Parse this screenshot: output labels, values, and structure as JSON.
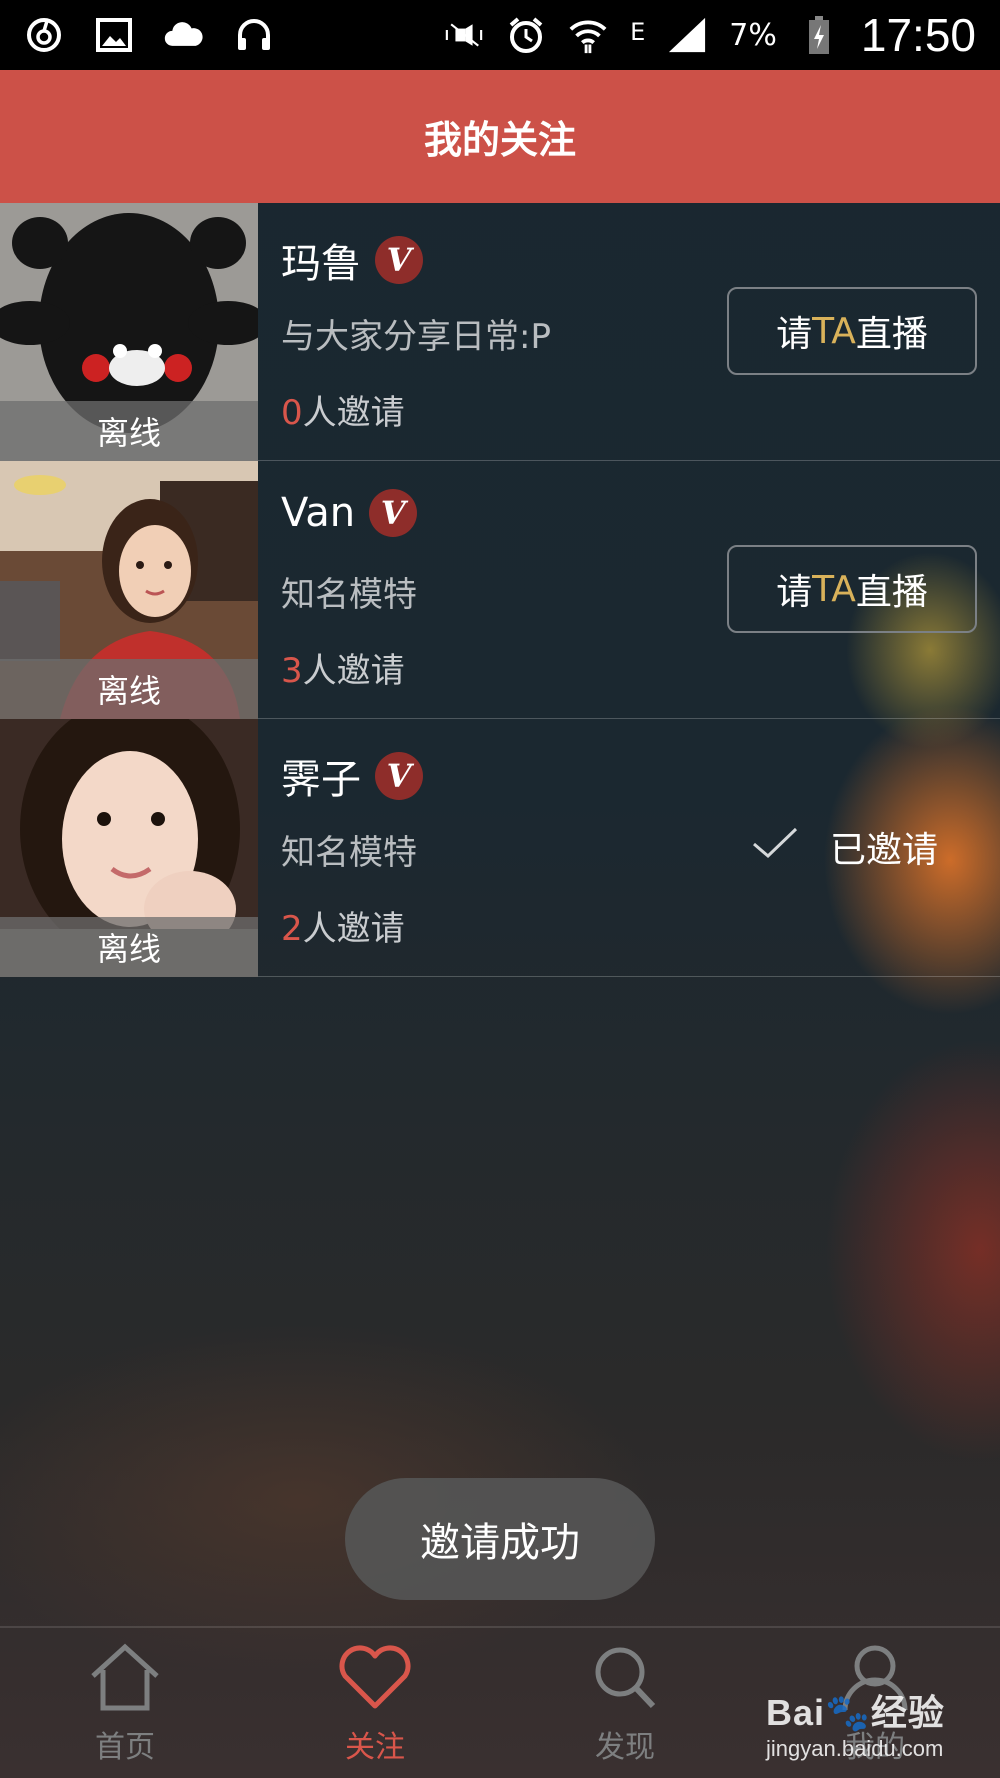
{
  "status_bar": {
    "battery": "7%",
    "network": "E",
    "time": "17:50",
    "left_icons": [
      "netease-music-icon",
      "gallery-icon",
      "cloud-icon",
      "headphones-icon"
    ],
    "right_icons": [
      "mute-icon",
      "alarm-icon",
      "wifi-icon",
      "signal-icon",
      "battery-icon"
    ]
  },
  "header": {
    "title": "我的关注"
  },
  "list": [
    {
      "name": "玛鲁",
      "badge": "V",
      "desc": "与大家分享日常:P",
      "count": "0",
      "count_suffix": "人邀请",
      "status": "离线",
      "action": "invite",
      "btn_pre": "请",
      "btn_ta": "TA",
      "btn_post": "直播"
    },
    {
      "name": "Van",
      "badge": "V",
      "desc": "知名模特",
      "count": "3",
      "count_suffix": "人邀请",
      "status": "离线",
      "action": "invite",
      "btn_pre": "请",
      "btn_ta": "TA",
      "btn_post": "直播"
    },
    {
      "name": "霁子",
      "badge": "V",
      "desc": "知名模特",
      "count": "2",
      "count_suffix": "人邀请",
      "status": "离线",
      "action": "invited",
      "invited_label": "已邀请"
    }
  ],
  "toast": "邀请成功",
  "tabs": [
    {
      "label": "首页",
      "icon": "home-icon",
      "active": false
    },
    {
      "label": "关注",
      "icon": "heart-icon",
      "active": true
    },
    {
      "label": "发现",
      "icon": "search-icon",
      "active": false
    },
    {
      "label": "我的",
      "icon": "profile-icon",
      "active": false
    }
  ],
  "watermark": {
    "logo": "Bai🐾经验",
    "url": "jingyan.baidu.com"
  },
  "colors": {
    "header": "#cc5148",
    "accent": "#d9564b",
    "ta": "#d9b25a"
  }
}
